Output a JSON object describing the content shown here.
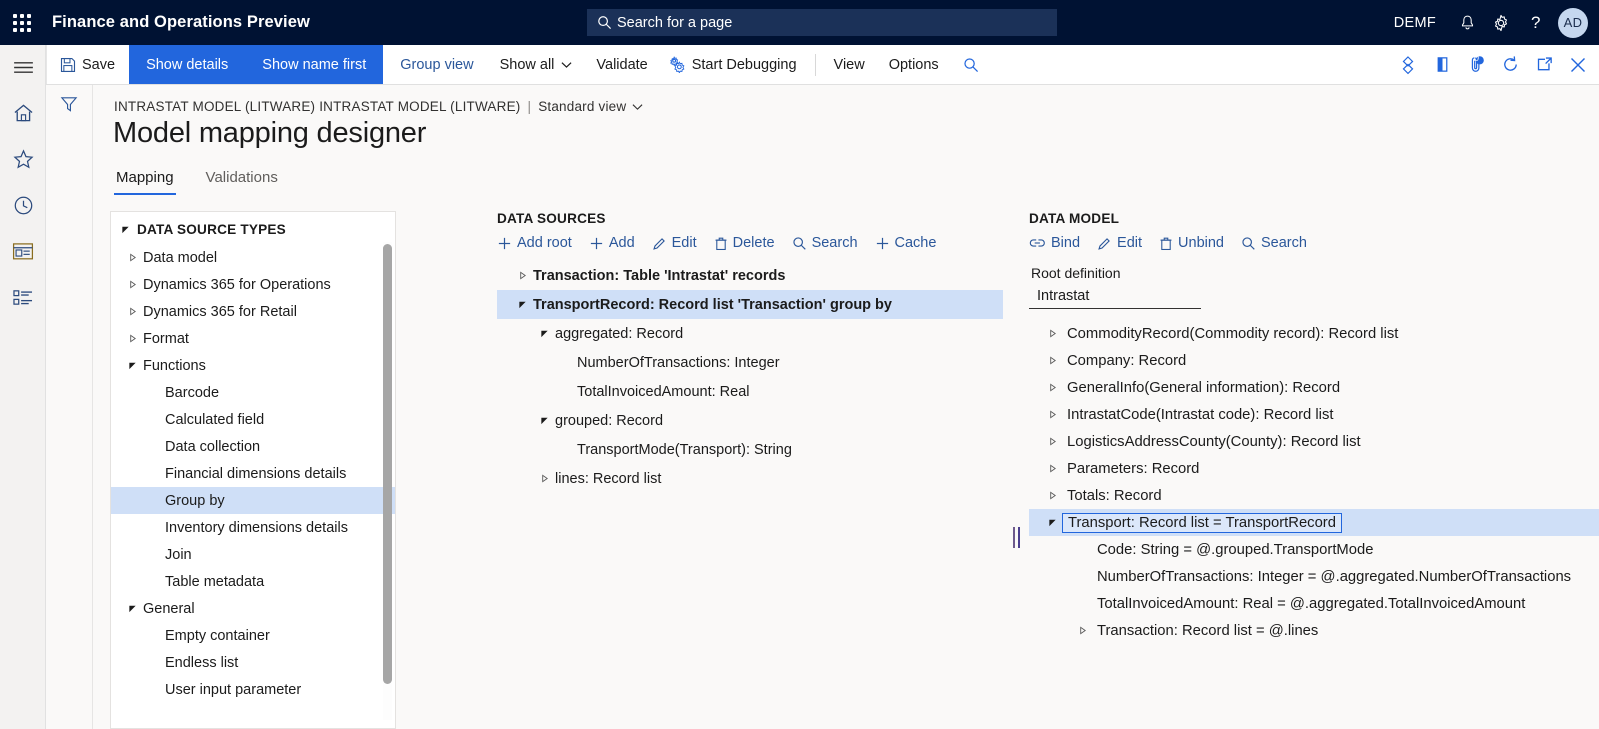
{
  "topbar": {
    "waffle_icon": "waffle-icon",
    "app_title": "Finance and Operations Preview",
    "search": {
      "icon": "search-icon",
      "placeholder": "Search for a page",
      "value": ""
    },
    "company": "DEMF",
    "notifications_icon": "bell-icon",
    "settings_icon": "gear-icon",
    "help_icon": "question-mark-icon",
    "avatar_initials": "AD",
    "bg_color": "#001233",
    "search_bg_color": "#1b3158"
  },
  "commandbar": {
    "hamburger_icon": "hamburger-icon",
    "save_label": "Save",
    "save_icon": "save-disk-icon",
    "show_details_label": "Show details",
    "show_name_first_label": "Show name first",
    "group_view_label": "Group view",
    "show_all_label": "Show all",
    "show_all_caret": "chevron-down-icon",
    "validate_label": "Validate",
    "start_debugging_label": "Start Debugging",
    "start_debugging_icon": "gears-icon",
    "view_label": "View",
    "options_label": "Options",
    "search_icon": "search-icon",
    "active_bg_color": "#2266dd",
    "link_color": "#2b579a",
    "right_icons": [
      "gem-icon",
      "open-in-office-icon",
      "attachment-icon",
      "refresh-icon",
      "popout-icon",
      "close-icon"
    ],
    "attachment_badge": "0"
  },
  "rail": {
    "items": [
      "hamburger-icon",
      "home-icon",
      "favorites-star-icon",
      "recent-clock-icon",
      "workspaces-icon",
      "modules-list-icon"
    ]
  },
  "filter_column": {
    "icon": "filter-funnel-icon"
  },
  "page": {
    "breadcrumb": {
      "path": "INTRASTAT MODEL (LITWARE) INTRASTAT MODEL (LITWARE)",
      "separator": "|",
      "view": "Standard view",
      "view_caret": "chevron-down-icon"
    },
    "title": "Model mapping designer",
    "tabs": [
      {
        "label": "Mapping",
        "active": true
      },
      {
        "label": "Validations",
        "active": false
      }
    ]
  },
  "data_source_types": {
    "header": "DATA SOURCE TYPES",
    "header_twisty": "expanded",
    "items": [
      {
        "label": "Data model",
        "twisty": "collapsed",
        "indent": 1,
        "selected": false
      },
      {
        "label": "Dynamics 365 for Operations",
        "twisty": "collapsed",
        "indent": 1,
        "selected": false
      },
      {
        "label": "Dynamics 365 for Retail",
        "twisty": "collapsed",
        "indent": 1,
        "selected": false
      },
      {
        "label": "Format",
        "twisty": "collapsed",
        "indent": 1,
        "selected": false
      },
      {
        "label": "Functions",
        "twisty": "expanded",
        "indent": 1,
        "selected": false
      },
      {
        "label": "Barcode",
        "twisty": "none",
        "indent": 2,
        "selected": false
      },
      {
        "label": "Calculated field",
        "twisty": "none",
        "indent": 2,
        "selected": false
      },
      {
        "label": "Data collection",
        "twisty": "none",
        "indent": 2,
        "selected": false
      },
      {
        "label": "Financial dimensions details",
        "twisty": "none",
        "indent": 2,
        "selected": false
      },
      {
        "label": "Group by",
        "twisty": "none",
        "indent": 2,
        "selected": true
      },
      {
        "label": "Inventory dimensions details",
        "twisty": "none",
        "indent": 2,
        "selected": false
      },
      {
        "label": "Join",
        "twisty": "none",
        "indent": 2,
        "selected": false
      },
      {
        "label": "Table metadata",
        "twisty": "none",
        "indent": 2,
        "selected": false
      },
      {
        "label": "General",
        "twisty": "expanded",
        "indent": 1,
        "selected": false
      },
      {
        "label": "Empty container",
        "twisty": "none",
        "indent": 2,
        "selected": false
      },
      {
        "label": "Endless list",
        "twisty": "none",
        "indent": 2,
        "selected": false
      },
      {
        "label": "User input parameter",
        "twisty": "none",
        "indent": 2,
        "selected": false
      }
    ],
    "selection_bg_color": "#cfdff7"
  },
  "data_sources": {
    "header": "DATA SOURCES",
    "toolbar": [
      {
        "label": "Add root",
        "icon": "plus-icon"
      },
      {
        "label": "Add",
        "icon": "plus-icon"
      },
      {
        "label": "Edit",
        "icon": "pencil-icon"
      },
      {
        "label": "Delete",
        "icon": "trash-icon"
      },
      {
        "label": "Search",
        "icon": "search-icon"
      },
      {
        "label": "Cache",
        "icon": "plus-icon"
      }
    ],
    "items": [
      {
        "label": "Transaction: Table 'Intrastat' records",
        "twisty": "collapsed",
        "indent": 0,
        "selected": false,
        "bold": true
      },
      {
        "label": "TransportRecord: Record list 'Transaction' group by",
        "twisty": "expanded",
        "indent": 0,
        "selected": true,
        "bold": true
      },
      {
        "label": "aggregated: Record",
        "twisty": "expanded",
        "indent": 1,
        "selected": false,
        "bold": false
      },
      {
        "label": "NumberOfTransactions: Integer",
        "twisty": "none",
        "indent": 2,
        "selected": false,
        "bold": false
      },
      {
        "label": "TotalInvoicedAmount: Real",
        "twisty": "none",
        "indent": 2,
        "selected": false,
        "bold": false
      },
      {
        "label": "grouped: Record",
        "twisty": "expanded",
        "indent": 1,
        "selected": false,
        "bold": false
      },
      {
        "label": "TransportMode(Transport): String",
        "twisty": "none",
        "indent": 2,
        "selected": false,
        "bold": false
      },
      {
        "label": "lines: Record list",
        "twisty": "collapsed",
        "indent": 1,
        "selected": false,
        "bold": false
      }
    ]
  },
  "splitter": {
    "name": "panel-splitter"
  },
  "data_model": {
    "header": "DATA MODEL",
    "toolbar": [
      {
        "label": "Bind",
        "icon": "link-icon"
      },
      {
        "label": "Edit",
        "icon": "pencil-icon"
      },
      {
        "label": "Unbind",
        "icon": "trash-icon"
      },
      {
        "label": "Search",
        "icon": "search-icon"
      }
    ],
    "root_definition_label": "Root definition",
    "root_definition_value": "Intrastat",
    "items": [
      {
        "label": "CommodityRecord(Commodity record): Record list",
        "twisty": "collapsed",
        "indent": 0,
        "selected": false
      },
      {
        "label": "Company: Record",
        "twisty": "collapsed",
        "indent": 0,
        "selected": false
      },
      {
        "label": "GeneralInfo(General information): Record",
        "twisty": "collapsed",
        "indent": 0,
        "selected": false
      },
      {
        "label": "IntrastatCode(Intrastat code): Record list",
        "twisty": "collapsed",
        "indent": 0,
        "selected": false
      },
      {
        "label": "LogisticsAddressCounty(County): Record list",
        "twisty": "collapsed",
        "indent": 0,
        "selected": false
      },
      {
        "label": "Parameters: Record",
        "twisty": "collapsed",
        "indent": 0,
        "selected": false
      },
      {
        "label": "Totals: Record",
        "twisty": "collapsed",
        "indent": 0,
        "selected": false
      },
      {
        "label": "Transport: Record list = TransportRecord",
        "twisty": "expanded",
        "indent": 0,
        "selected": true,
        "boxed": true
      },
      {
        "label": "Code: String = @.grouped.TransportMode",
        "twisty": "none",
        "indent": 1,
        "selected": false
      },
      {
        "label": "NumberOfTransactions: Integer = @.aggregated.NumberOfTransactions",
        "twisty": "none",
        "indent": 1,
        "selected": false
      },
      {
        "label": "TotalInvoicedAmount: Real = @.aggregated.TotalInvoicedAmount",
        "twisty": "none",
        "indent": 1,
        "selected": false
      },
      {
        "label": "Transaction: Record list = @.lines",
        "twisty": "collapsed",
        "indent": 1,
        "selected": false
      }
    ],
    "selection_bg_color": "#cfdff7",
    "selection_border_color": "#2266dd"
  }
}
